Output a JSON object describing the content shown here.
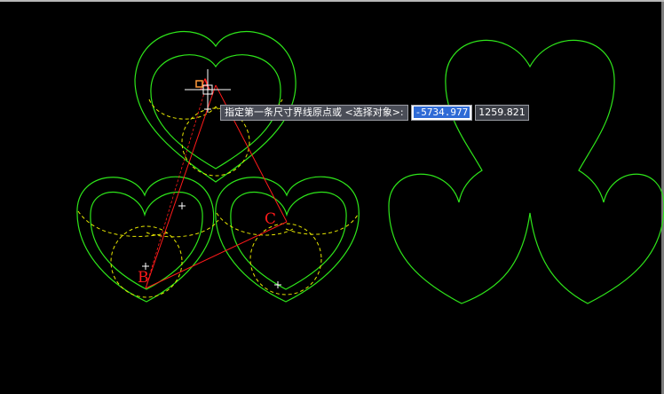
{
  "colors": {
    "background": "#000000",
    "outline": "#2ee61a",
    "construction": "#e6e600",
    "dimension": "#ff1a1a",
    "cursor": "#ffffff",
    "snap_marker": "#ff9a3c"
  },
  "labels": {
    "point_a": "A",
    "point_b": "B",
    "point_c": "C"
  },
  "dynamic_input": {
    "prompt": "指定第一条尺寸界线原点或 <选择对象>:",
    "x_value": "-5734.977",
    "y_value": "1259.821"
  }
}
